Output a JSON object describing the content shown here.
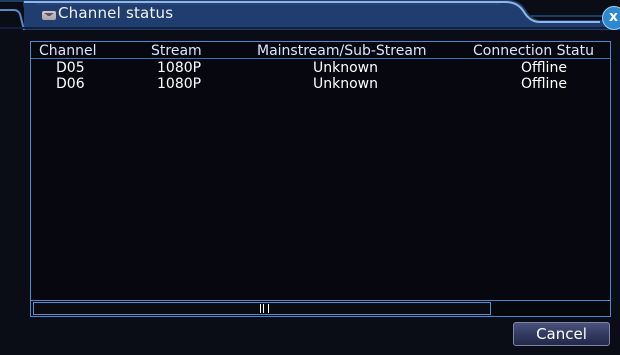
{
  "window": {
    "title": "Channel status",
    "title_icon": "mail-icon",
    "close_icon": "close-icon",
    "close_symbol": "x"
  },
  "table": {
    "columns": [
      "Channel",
      "Stream",
      "Mainstream/Sub-Stream",
      "Connection Statu"
    ],
    "rows": [
      {
        "channel": "D05",
        "stream": "1080P",
        "mainstream": "Unknown",
        "connection": "Offline"
      },
      {
        "channel": "D06",
        "stream": "1080P",
        "mainstream": "Unknown",
        "connection": "Offline"
      }
    ]
  },
  "buttons": {
    "cancel": "Cancel"
  },
  "colors": {
    "background": "#0b0d16",
    "accent_blue": "#4b8ad1",
    "title_text": "#f2f2f2"
  }
}
